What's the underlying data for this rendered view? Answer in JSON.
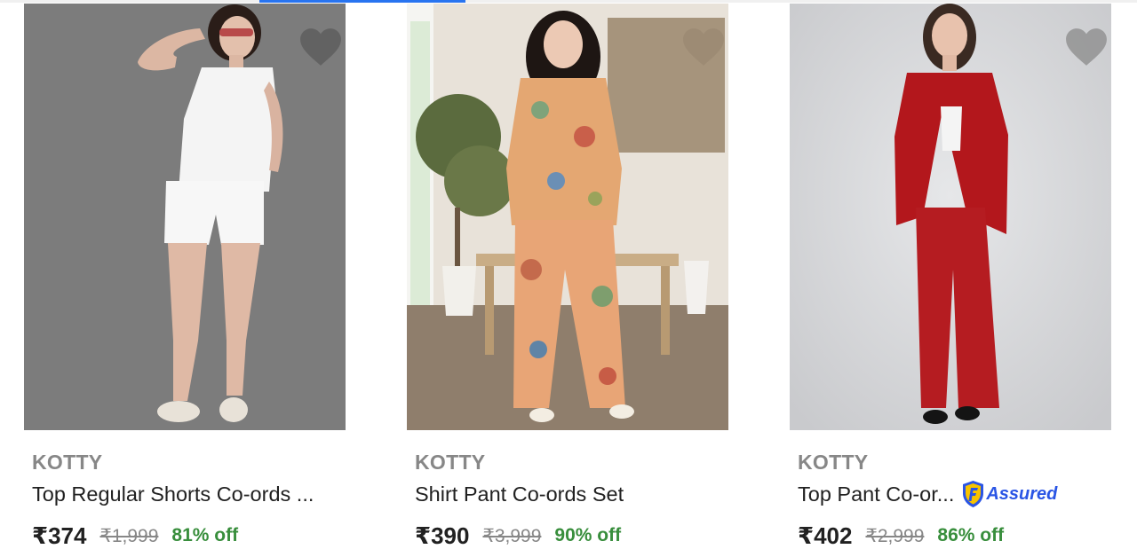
{
  "theme": {
    "accent": "#2874f0",
    "brand_gray": "#878787",
    "discount_green": "#388e3c",
    "assured_blue": "#2a55e5"
  },
  "products": [
    {
      "brand": "KOTTY",
      "title": "Top Regular Shorts Co-ords ...",
      "price": "₹374",
      "mrp": "₹1,999",
      "discount": "81% off",
      "assured": false,
      "wishlist_icon": "heart-icon",
      "image_bg": "#7a7a7a"
    },
    {
      "brand": "KOTTY",
      "title": "Shirt Pant Co-ords Set",
      "price": "₹390",
      "mrp": "₹3,999",
      "discount": "90% off",
      "assured": false,
      "wishlist_icon": "heart-icon",
      "image_bg": "#e9e3da"
    },
    {
      "brand": "KOTTY",
      "title": "Top Pant Co-or...",
      "price": "₹402",
      "mrp": "₹2,999",
      "discount": "86% off",
      "assured": true,
      "assured_label": "Assured",
      "wishlist_icon": "heart-icon",
      "image_bg": "#d7d8da"
    }
  ]
}
